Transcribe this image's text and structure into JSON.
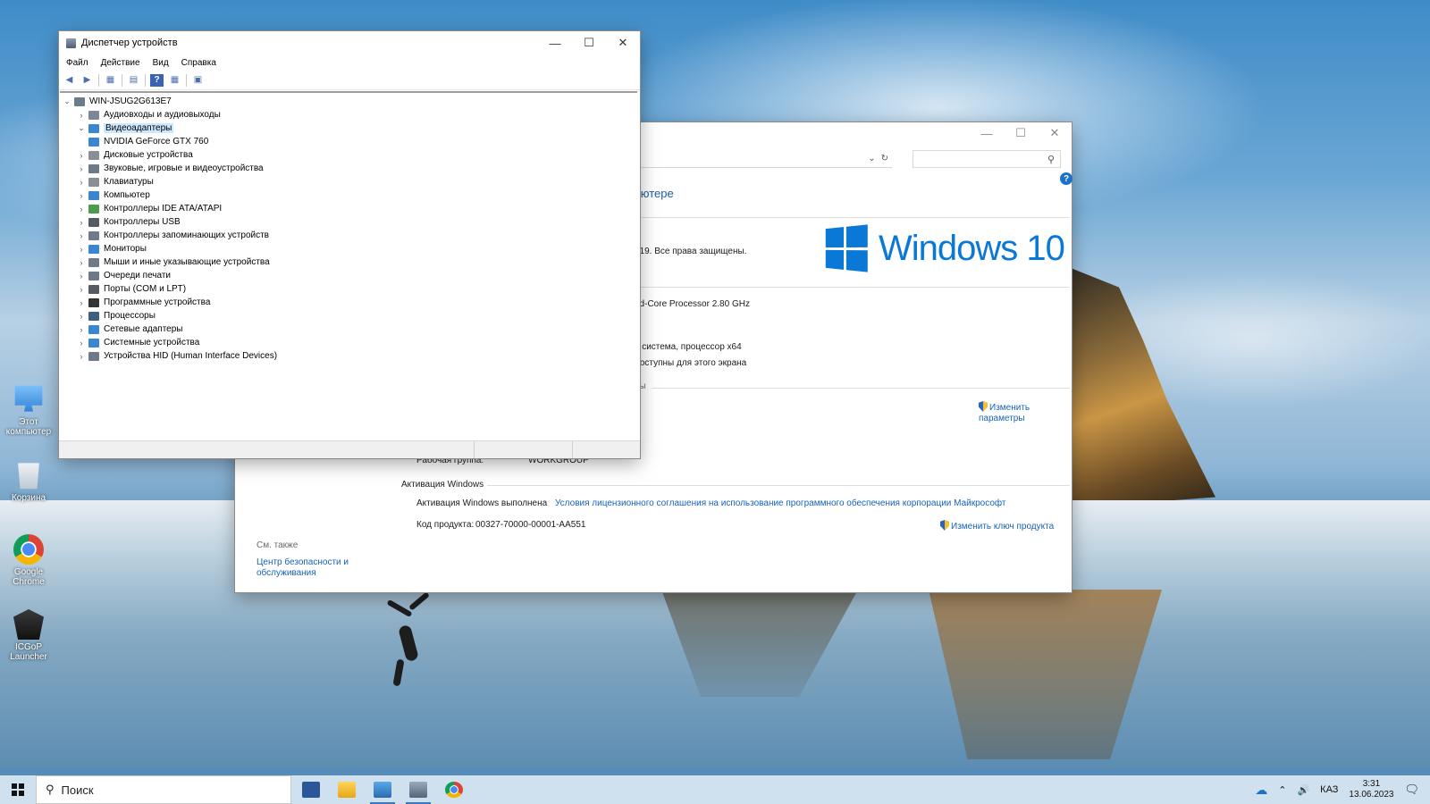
{
  "desktop": {
    "icons": [
      {
        "label": "Этот компьютер",
        "icon": "computer-icon"
      },
      {
        "label": "Корзина",
        "icon": "recycle-bin-icon"
      },
      {
        "label": "Google Chrome",
        "icon": "chrome-icon"
      },
      {
        "label": "ICGoP Launcher",
        "icon": "launcher-icon"
      }
    ]
  },
  "device_manager": {
    "title": "Диспетчер устройств",
    "menu": [
      "Файл",
      "Действие",
      "Вид",
      "Справка"
    ],
    "root": "WIN-JSUG2G613E7",
    "items": [
      {
        "label": "Аудиовходы и аудиовыходы",
        "expanded": false
      },
      {
        "label": "Видеоадаптеры",
        "expanded": true,
        "selected": true
      },
      {
        "label": "NVIDIA GeForce GTX 760",
        "child": true
      },
      {
        "label": "Дисковые устройства",
        "expanded": false
      },
      {
        "label": "Звуковые, игровые и видеоустройства",
        "expanded": false
      },
      {
        "label": "Клавиатуры",
        "expanded": false
      },
      {
        "label": "Компьютер",
        "expanded": false
      },
      {
        "label": "Контроллеры IDE ATA/ATAPI",
        "expanded": false
      },
      {
        "label": "Контроллеры USB",
        "expanded": false
      },
      {
        "label": "Контроллеры запоминающих устройств",
        "expanded": false
      },
      {
        "label": "Мониторы",
        "expanded": false
      },
      {
        "label": "Мыши и иные указывающие устройства",
        "expanded": false
      },
      {
        "label": "Очереди печати",
        "expanded": false
      },
      {
        "label": "Порты (COM и LPT)",
        "expanded": false
      },
      {
        "label": "Программные устройства",
        "expanded": false
      },
      {
        "label": "Процессоры",
        "expanded": false
      },
      {
        "label": "Сетевые адаптеры",
        "expanded": false
      },
      {
        "label": "Системные устройства",
        "expanded": false
      },
      {
        "label": "Устройства HID (Human Interface Devices)",
        "expanded": false
      }
    ]
  },
  "system": {
    "section_title": "ьютере",
    "copyright": "019. Все права защищены.",
    "logo_text": "Windows 10",
    "processor": "ad-Core Processor   2.80 GHz",
    "system_type": "я система, процессор x64",
    "pen": "доступны для этого экрана",
    "params_partial": "ры",
    "change_params": "Изменить параметры",
    "workgroup_label": "Рабочая группа:",
    "workgroup_value": "WORKGROUP",
    "activation_header": "Активация Windows",
    "activation_status": "Активация Windows выполнена",
    "license_link": "Условия лицензионного соглашения на использование программного обеспечения корпорации Майкрософт",
    "product_key_label": "Код продукта:",
    "product_key_value": "00327-70000-00001-AA551",
    "change_key": "Изменить ключ продукта",
    "see_also": "См. также",
    "security_center": "Центр безопасности и обслуживания"
  },
  "taskbar": {
    "search_placeholder": "Поиск",
    "language": "КАЗ",
    "time": "3:31",
    "date": "13.06.2023"
  },
  "colors": {
    "accent": "#0a78d7",
    "link": "#1762b8",
    "selection": "#cce8ff"
  }
}
